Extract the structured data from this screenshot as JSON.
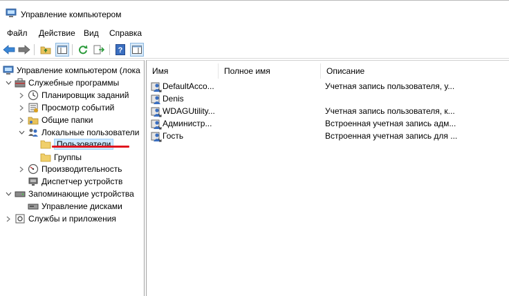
{
  "window": {
    "title": "Управление компьютером"
  },
  "menu": [
    "Файл",
    "Действие",
    "Вид",
    "Справка"
  ],
  "toolbar": {
    "icons": [
      "back-arrow-icon",
      "forward-arrow-icon",
      "up-folder-icon",
      "show-hide-tree-icon",
      "refresh-icon",
      "export-list-icon",
      "help-icon",
      "show-hide-action-pane-icon"
    ]
  },
  "tree": {
    "root": "Управление компьютером (лока",
    "system_tools": "Служебные программы",
    "task_scheduler": "Планировщик заданий",
    "event_viewer": "Просмотр событий",
    "shared_folders": "Общие папки",
    "local_users": "Локальные пользователи",
    "users": "Пользователи",
    "groups": "Группы",
    "performance": "Производительность",
    "device_manager": "Диспетчер устройств",
    "storage": "Запоминающие устройства",
    "disk_management": "Управление дисками",
    "services_apps": "Службы и приложения"
  },
  "list": {
    "columns": {
      "name": "Имя",
      "full_name": "Полное имя",
      "description": "Описание"
    },
    "rows": [
      {
        "name": "DefaultAcco...",
        "full_name": "",
        "description": "Учетная запись пользователя, у..."
      },
      {
        "name": "Denis",
        "full_name": "",
        "description": ""
      },
      {
        "name": "WDAGUtility...",
        "full_name": "",
        "description": "Учетная запись пользователя, к..."
      },
      {
        "name": "Администр...",
        "full_name": "",
        "description": "Встроенная учетная запись адм..."
      },
      {
        "name": "Гость",
        "full_name": "",
        "description": "Встроенная учетная запись для ..."
      }
    ]
  },
  "colors": {
    "selection": "#cce8ff",
    "annotation": "#e0141e"
  }
}
